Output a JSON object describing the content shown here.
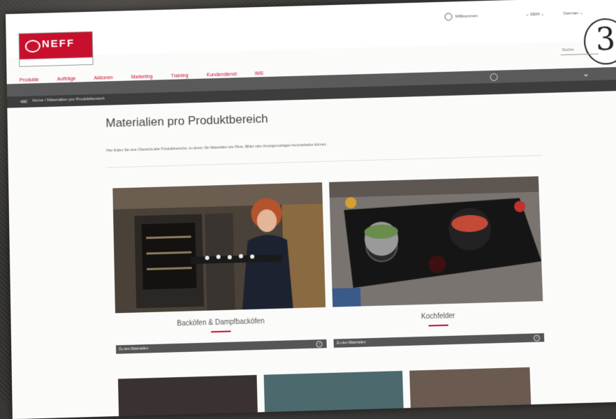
{
  "header": {
    "logo_text": "NEFF",
    "account_label": "Willkommen",
    "lang_a": "DEM",
    "lang_b": "German",
    "search_placeholder": "Suche",
    "corner_number": "3"
  },
  "nav": {
    "items": [
      "Produkte",
      "Aufträge",
      "Aktionen",
      "Marketing",
      "Training",
      "Kundendienst",
      "IMS"
    ]
  },
  "breadcrumb": {
    "text": "Home / Materialien pro Produktbereich"
  },
  "main": {
    "title": "Materialien pro Produktbereich",
    "intro": "Hier finden Sie eine Übersicht aller Produktbereiche, zu denen Sie Materialien wie Filme, Bilder oder Anzeigenvorlagen herunterladen können."
  },
  "cards": [
    {
      "title": "Backöfen & Dampfbacköfen",
      "button": "Zu den Materialien"
    },
    {
      "title": "Kochfelder",
      "button": "Zu den Materialien"
    }
  ],
  "colors": {
    "brand_red": "#c8102e",
    "nav_dark": "#5a5a5a",
    "crumb_dark": "#3d3d3d"
  }
}
